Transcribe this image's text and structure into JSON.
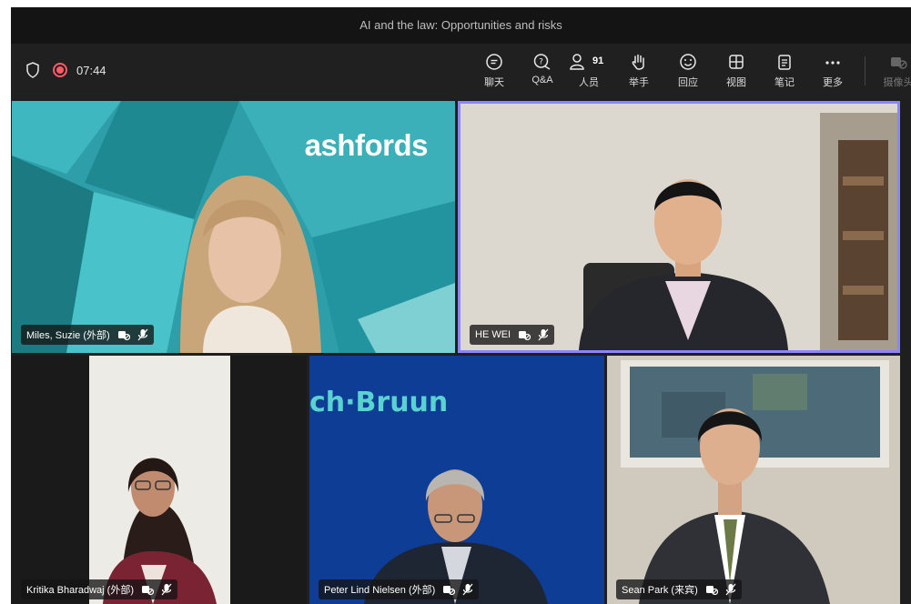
{
  "meeting": {
    "title": "AI and the law: Opportunities and risks",
    "elapsed": "07:44"
  },
  "toolbar": {
    "chat": "聊天",
    "qa": "Q&A",
    "people": "人员",
    "people_count": "91",
    "raise_hand": "举手",
    "react": "回应",
    "view": "视图",
    "notes": "笔记",
    "more": "更多",
    "camera": "摄像头"
  },
  "tiles": {
    "t1": {
      "name": "Miles, Suzie (外部)",
      "logo": "ashfords"
    },
    "t2": {
      "name": "HE WEI"
    },
    "t3": {
      "name": "Kritika Bharadwaj (外部)"
    },
    "t4": {
      "name": "Peter Lind Nielsen (外部)",
      "logo": "ch·Bruun"
    },
    "t5": {
      "name": "Sean Park (来宾)"
    }
  },
  "colors": {
    "active_speaker_border": "#8b86ff",
    "record": "#ff5a66"
  }
}
